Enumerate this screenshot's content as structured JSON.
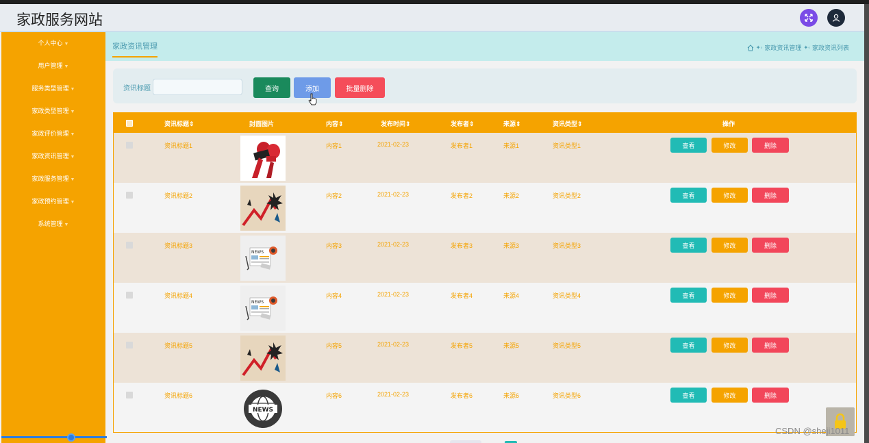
{
  "header": {
    "title": "家政服务网站",
    "expand_icon": "expand-icon",
    "user_icon": "user-icon"
  },
  "sidebar": {
    "items": [
      {
        "label": "个人中心"
      },
      {
        "label": "用户管理"
      },
      {
        "label": "服务类型管理"
      },
      {
        "label": "家政类型管理"
      },
      {
        "label": "家政评价管理"
      },
      {
        "label": "家政资讯管理"
      },
      {
        "label": "家政服务管理"
      },
      {
        "label": "家政预约管理"
      },
      {
        "label": "系统管理"
      }
    ]
  },
  "tab": {
    "label": "家政资讯管理"
  },
  "breadcrumb": {
    "items": [
      "家政资讯管理",
      "家政资讯列表"
    ]
  },
  "search": {
    "label": "资讯标题",
    "placeholder": "",
    "value": ""
  },
  "buttons": {
    "query": "查询",
    "add": "添加",
    "batch_delete": "批量删除"
  },
  "table": {
    "headers": [
      "资讯标题",
      "封面图片",
      "内容",
      "发布时间",
      "发布者",
      "来源",
      "资讯类型",
      "操作"
    ],
    "rows": [
      {
        "title": "资讯标题1",
        "image": "microphone-live-image",
        "content": "内容1",
        "time": "2021-02-23",
        "publisher": "发布者1",
        "source": "来源1",
        "type": "资讯类型1"
      },
      {
        "title": "资讯标题2",
        "image": "breaking-news-chart-image",
        "content": "内容2",
        "time": "2021-02-23",
        "publisher": "发布者2",
        "source": "来源2",
        "type": "资讯类型2"
      },
      {
        "title": "资讯标题3",
        "image": "news-paper-image",
        "content": "内容3",
        "time": "2021-02-23",
        "publisher": "发布者3",
        "source": "来源3",
        "type": "资讯类型3"
      },
      {
        "title": "资讯标题4",
        "image": "news-paper-image",
        "content": "内容4",
        "time": "2021-02-23",
        "publisher": "发布者4",
        "source": "来源4",
        "type": "资讯类型4"
      },
      {
        "title": "资讯标题5",
        "image": "breaking-news-chart-image",
        "content": "内容5",
        "time": "2021-02-23",
        "publisher": "发布者5",
        "source": "来源5",
        "type": "资讯类型5"
      },
      {
        "title": "资讯标题6",
        "image": "news-globe-image",
        "content": "内容6",
        "time": "2021-02-23",
        "publisher": "发布者6",
        "source": "来源6",
        "type": "资讯类型6"
      }
    ],
    "actions": {
      "view": "查看",
      "edit": "修改",
      "delete": "删除"
    }
  },
  "watermark": "CSDN @sheji1011",
  "colors": {
    "accent": "#f5a300",
    "teal": "#21bbb5",
    "danger": "#f2465a",
    "query": "#1a8a5c",
    "add": "#6e9be8"
  }
}
